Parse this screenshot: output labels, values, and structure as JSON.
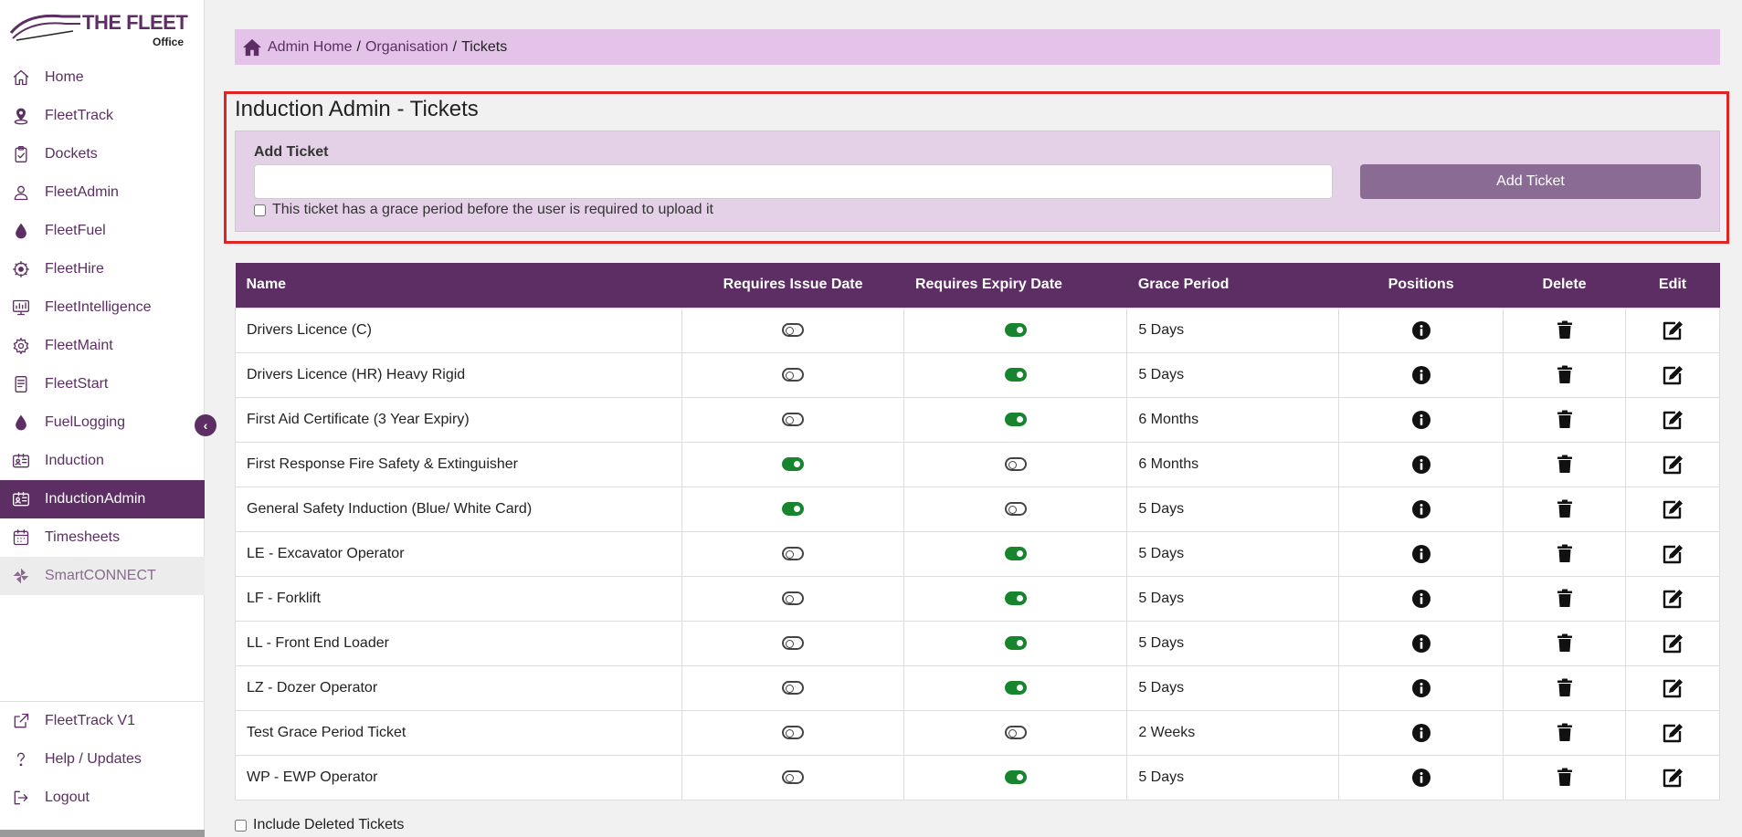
{
  "logo": {
    "line1": "THE FLEET",
    "line2": "Office"
  },
  "sidebar": {
    "items": [
      {
        "label": "Home",
        "icon": "home-icon",
        "state": "normal"
      },
      {
        "label": "FleetTrack",
        "icon": "map-pin-icon",
        "state": "normal"
      },
      {
        "label": "Dockets",
        "icon": "clipboard-icon",
        "state": "normal"
      },
      {
        "label": "FleetAdmin",
        "icon": "user-icon",
        "state": "normal"
      },
      {
        "label": "FleetFuel",
        "icon": "droplet-icon",
        "state": "normal"
      },
      {
        "label": "FleetHire",
        "icon": "gear-handshake-icon",
        "state": "normal"
      },
      {
        "label": "FleetIntelligence",
        "icon": "monitor-chart-icon",
        "state": "normal"
      },
      {
        "label": "FleetMaint",
        "icon": "gear-icon",
        "state": "normal"
      },
      {
        "label": "FleetStart",
        "icon": "checklist-icon",
        "state": "normal"
      },
      {
        "label": "FuelLogging",
        "icon": "droplet-icon",
        "state": "normal"
      },
      {
        "label": "Induction",
        "icon": "id-card-icon",
        "state": "normal"
      },
      {
        "label": "InductionAdmin",
        "icon": "id-card-icon",
        "state": "active"
      },
      {
        "label": "Timesheets",
        "icon": "calendar-icon",
        "state": "normal"
      },
      {
        "label": "SmartCONNECT",
        "icon": "pinwheel-icon",
        "state": "disabled"
      }
    ],
    "bottom": [
      {
        "label": "FleetTrack V1",
        "icon": "external-link-icon"
      },
      {
        "label": "Help / Updates",
        "icon": "question-icon"
      },
      {
        "label": "Logout",
        "icon": "logout-icon"
      }
    ],
    "collapse_glyph": "‹"
  },
  "breadcrumb": {
    "home": "Admin Home",
    "org": "Organisation",
    "current": "Tickets",
    "sep": "/"
  },
  "page": {
    "title": "Induction Admin - Tickets",
    "add_label": "Add Ticket",
    "add_input_value": "",
    "add_input_placeholder": "",
    "grace_checkbox_label": "This ticket has a grace period before the user is required to upload it",
    "add_button": "Add Ticket",
    "include_deleted_label": "Include Deleted Tickets"
  },
  "table": {
    "headers": [
      "Name",
      "Requires Issue Date",
      "Requires Expiry Date",
      "Grace Period",
      "Positions",
      "Delete",
      "Edit"
    ],
    "rows": [
      {
        "name": "Drivers Licence (C)",
        "issue": false,
        "expiry": true,
        "grace": "5 Days"
      },
      {
        "name": "Drivers Licence (HR) Heavy Rigid",
        "issue": false,
        "expiry": true,
        "grace": "5 Days"
      },
      {
        "name": "First Aid Certificate (3 Year Expiry)",
        "issue": false,
        "expiry": true,
        "grace": "6 Months"
      },
      {
        "name": "First Response Fire Safety & Extinguisher",
        "issue": true,
        "expiry": false,
        "grace": "6 Months"
      },
      {
        "name": "General Safety Induction (Blue/ White Card)",
        "issue": true,
        "expiry": false,
        "grace": "5 Days"
      },
      {
        "name": "LE - Excavator Operator",
        "issue": false,
        "expiry": true,
        "grace": "5 Days"
      },
      {
        "name": "LF - Forklift",
        "issue": false,
        "expiry": true,
        "grace": "5 Days"
      },
      {
        "name": "LL - Front End Loader",
        "issue": false,
        "expiry": true,
        "grace": "5 Days"
      },
      {
        "name": "LZ - Dozer Operator",
        "issue": false,
        "expiry": true,
        "grace": "5 Days"
      },
      {
        "name": "Test Grace Period Ticket",
        "issue": false,
        "expiry": false,
        "grace": "2 Weeks"
      },
      {
        "name": "WP - EWP Operator",
        "issue": false,
        "expiry": true,
        "grace": "5 Days"
      }
    ]
  },
  "colors": {
    "brand": "#5c2e63",
    "breadcrumb_bg": "#e3c3e7",
    "panel_bg": "#e4d1e8",
    "toggle_on": "#17842e",
    "highlight": "#e02424"
  }
}
